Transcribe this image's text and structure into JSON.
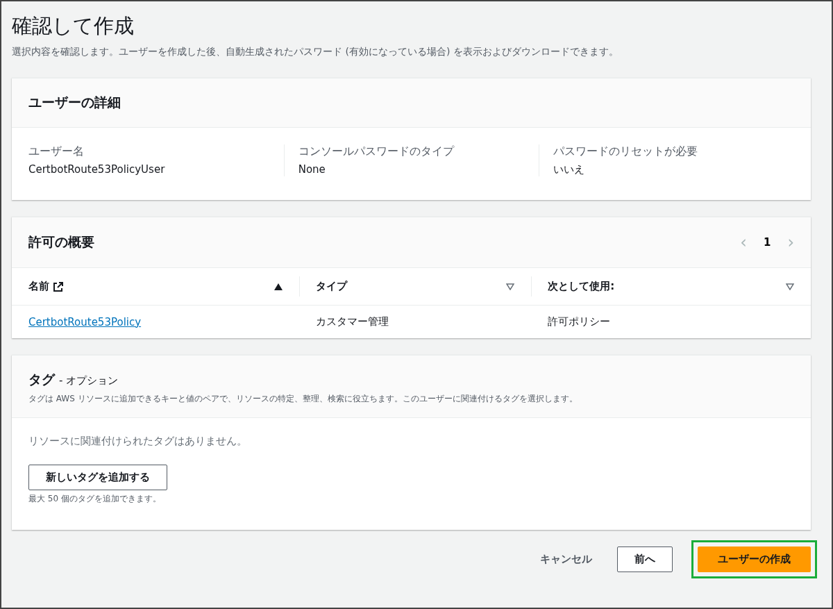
{
  "page": {
    "title": "確認して作成",
    "description": "選択内容を確認します。ユーザーを作成した後、自動生成されたパスワード (有効になっている場合) を表示およびダウンロードできます。"
  },
  "user_details": {
    "title": "ユーザーの詳細",
    "fields": [
      {
        "label": "ユーザー名",
        "value": "CertbotRoute53PolicyUser"
      },
      {
        "label": "コンソールパスワードのタイプ",
        "value": "None"
      },
      {
        "label": "パスワードのリセットが必要",
        "value": "いいえ"
      }
    ]
  },
  "permissions": {
    "title": "許可の概要",
    "pagination": {
      "prev": "‹",
      "page": "1",
      "next": "›"
    },
    "columns": [
      {
        "label": "名前",
        "external_link": true,
        "sorted": true
      },
      {
        "label": "タイプ",
        "external_link": false,
        "sorted": false
      },
      {
        "label": "次として使用:",
        "external_link": false,
        "sorted": false
      }
    ],
    "rows": [
      {
        "name": "CertbotRoute53Policy",
        "type": "カスタマー管理",
        "used_as": "許可ポリシー"
      }
    ]
  },
  "tags": {
    "title": "タグ",
    "title_suffix": "- オプション",
    "description": "タグは AWS リソースに追加できるキーと値のペアで、リソースの特定、整理、検索に役立ちます。このユーザーに関連付けるタグを選択します。",
    "empty_text": "リソースに関連付けられたタグはありません。",
    "add_button": "新しいタグを追加する",
    "limit_hint": "最大 50 個のタグを追加できます。"
  },
  "footer": {
    "buttons": [
      {
        "kind": "link",
        "label": "キャンセル",
        "highlighted": false
      },
      {
        "kind": "normal",
        "label": "前へ",
        "highlighted": false
      },
      {
        "kind": "primary",
        "label": "ユーザーの作成",
        "highlighted": true
      }
    ]
  }
}
